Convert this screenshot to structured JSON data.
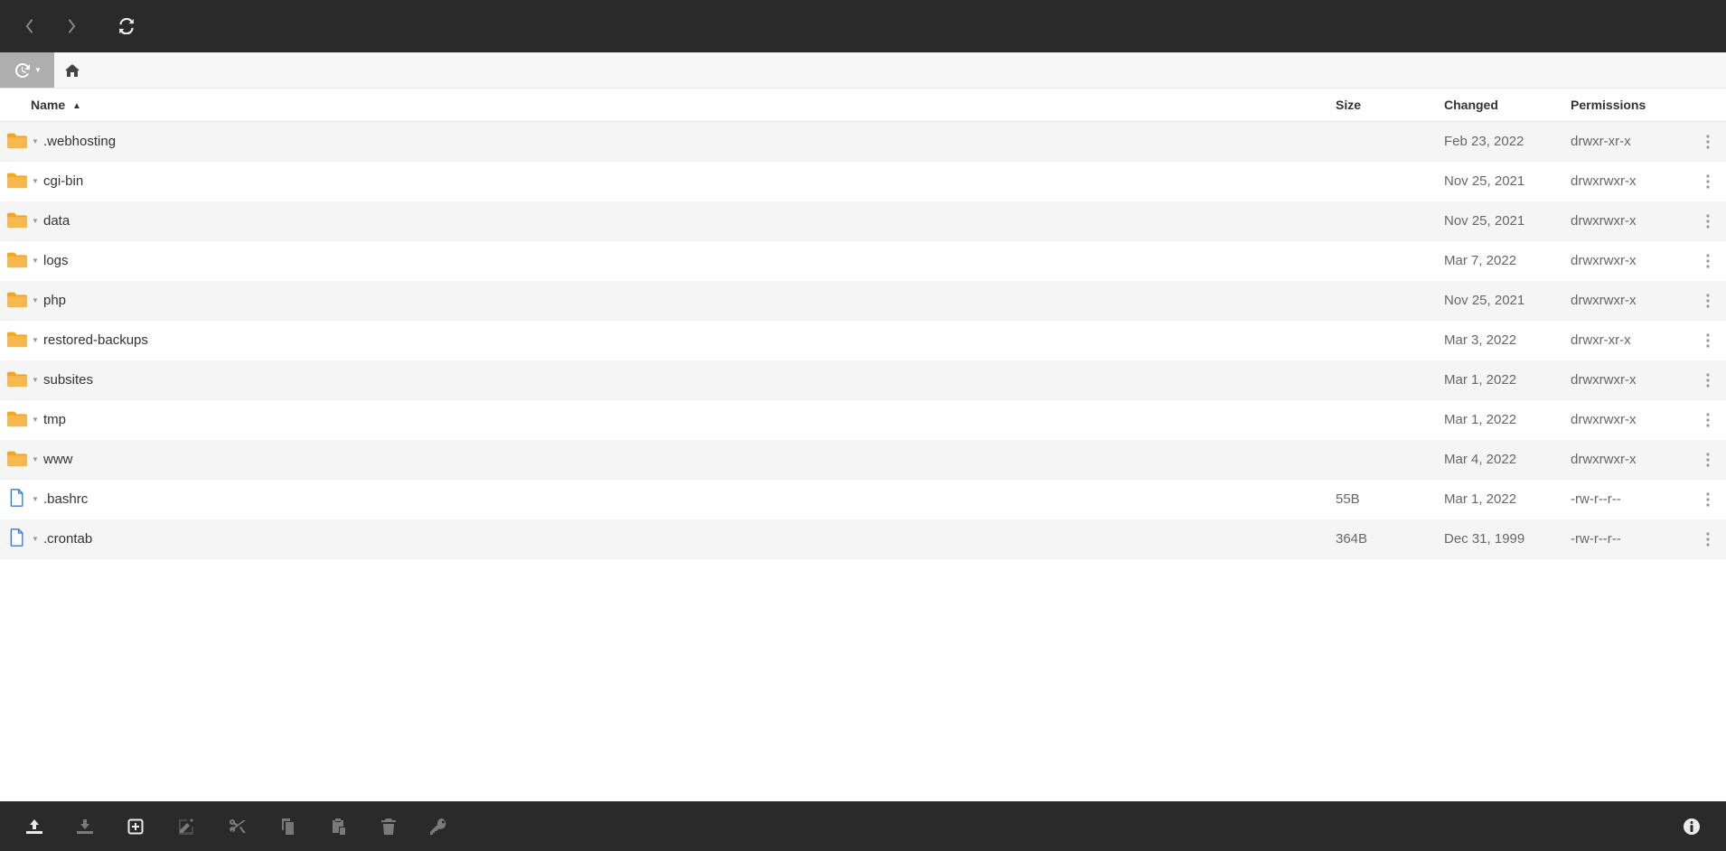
{
  "columns": {
    "name": "Name",
    "size": "Size",
    "changed": "Changed",
    "permissions": "Permissions"
  },
  "sort": {
    "column": "name",
    "dir": "asc"
  },
  "rows": [
    {
      "type": "folder",
      "name": ".webhosting",
      "size": "",
      "changed": "Feb 23, 2022",
      "permissions": "drwxr-xr-x"
    },
    {
      "type": "folder",
      "name": "cgi-bin",
      "size": "",
      "changed": "Nov 25, 2021",
      "permissions": "drwxrwxr-x"
    },
    {
      "type": "folder",
      "name": "data",
      "size": "",
      "changed": "Nov 25, 2021",
      "permissions": "drwxrwxr-x"
    },
    {
      "type": "folder",
      "name": "logs",
      "size": "",
      "changed": "Mar 7, 2022",
      "permissions": "drwxrwxr-x"
    },
    {
      "type": "folder",
      "name": "php",
      "size": "",
      "changed": "Nov 25, 2021",
      "permissions": "drwxrwxr-x"
    },
    {
      "type": "folder",
      "name": "restored-backups",
      "size": "",
      "changed": "Mar 3, 2022",
      "permissions": "drwxr-xr-x"
    },
    {
      "type": "folder",
      "name": "subsites",
      "size": "",
      "changed": "Mar 1, 2022",
      "permissions": "drwxrwxr-x"
    },
    {
      "type": "folder",
      "name": "tmp",
      "size": "",
      "changed": "Mar 1, 2022",
      "permissions": "drwxrwxr-x"
    },
    {
      "type": "folder",
      "name": "www",
      "size": "",
      "changed": "Mar 4, 2022",
      "permissions": "drwxrwxr-x"
    },
    {
      "type": "file",
      "name": ".bashrc",
      "size": "55B",
      "changed": "Mar 1, 2022",
      "permissions": "-rw-r--r--"
    },
    {
      "type": "file",
      "name": ".crontab",
      "size": "364B",
      "changed": "Dec 31, 1999",
      "permissions": "-rw-r--r--"
    }
  ],
  "topbar": {
    "back_enabled": false,
    "forward_enabled": false,
    "refresh_enabled": true
  },
  "bottombar": {
    "upload_enabled": true,
    "download_enabled": false,
    "new_enabled": true,
    "edit_enabled": false,
    "cut_enabled": false,
    "copy_enabled": false,
    "paste_enabled": false,
    "delete_enabled": false,
    "permissions_enabled": false,
    "info_enabled": true
  }
}
